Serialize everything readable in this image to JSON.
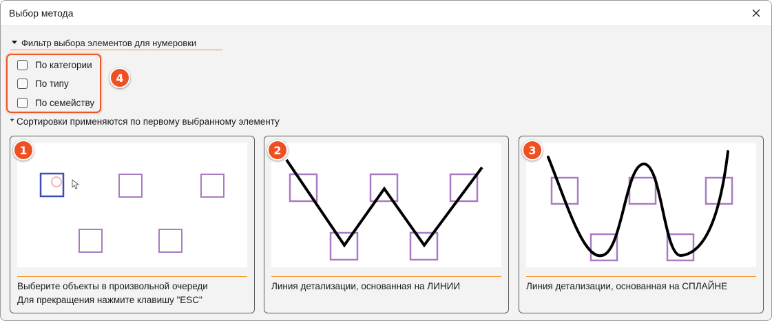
{
  "window": {
    "title": "Выбор метода",
    "close_icon": "close-icon"
  },
  "filter": {
    "expander_label": "Фильтр выбора элементов для нумеровки",
    "expanded": true,
    "badge": "4",
    "options": [
      {
        "label": "По категории",
        "checked": false
      },
      {
        "label": "По типу",
        "checked": false
      },
      {
        "label": "По семейству",
        "checked": false
      }
    ],
    "note": "* Сортировки применяются по первому выбранному элементу"
  },
  "methods": [
    {
      "badge": "1",
      "line1": "Выберите объекты в произвольной очереди",
      "line2": "Для прекращения нажмите клавишу \"ESC\""
    },
    {
      "badge": "2",
      "line1": "Линия детализации, основанная на ЛИНИИ"
    },
    {
      "badge": "3",
      "line1": "Линия детализации, основанная на СПЛАЙНЕ"
    }
  ],
  "colors": {
    "accent_orange": "#f7931e",
    "badge_red": "#ef5022",
    "square_purple": "#a87bc4",
    "selected_blue": "#3b4db8",
    "curve_black": "#000000"
  }
}
